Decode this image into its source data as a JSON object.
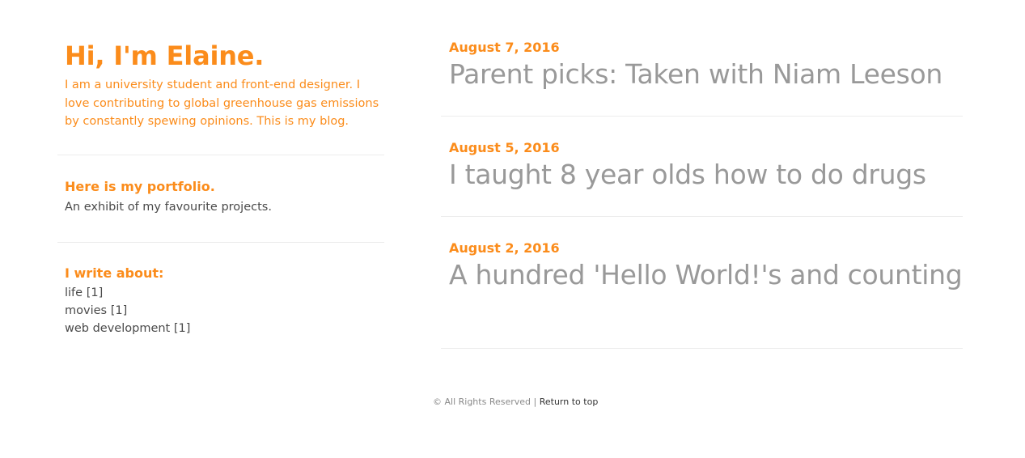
{
  "sidebar": {
    "title": "Hi, I'm Elaine.",
    "bio": "I am a university student and front-end designer. I love contributing to global greenhouse gas emissions by constantly spewing opinions. This is my blog.",
    "portfolio": {
      "heading": "Here is my portfolio.",
      "description": "An exhibit of my favourite projects."
    },
    "topics": {
      "heading": "I write about:",
      "items": [
        {
          "label": "life [1]"
        },
        {
          "label": "movies [1]"
        },
        {
          "label": "web development [1]"
        }
      ]
    }
  },
  "posts": [
    {
      "date": "August 7, 2016",
      "title": "Parent picks: Taken with Niam Leeson"
    },
    {
      "date": "August 5, 2016",
      "title": "I taught 8 year olds how to do drugs"
    },
    {
      "date": "August 2, 2016",
      "title": "A hundred 'Hello World!'s and counting"
    }
  ],
  "footer": {
    "copyright": "© All Rights Reserved",
    "separator": " | ",
    "top_link": "Return to top"
  },
  "colors": {
    "accent": "#fb8c1b",
    "post_title": "#999999",
    "body_text": "#4a4a4a",
    "divider": "#ececec"
  }
}
